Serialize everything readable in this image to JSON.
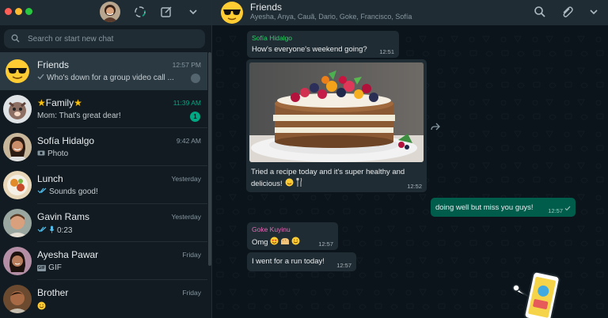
{
  "sidebar": {
    "search_placeholder": "Search or start new chat",
    "chats": [
      {
        "name": "Friends",
        "preview": "Who's down for a group video call ...",
        "time": "12:57 PM"
      },
      {
        "name": "Family",
        "preview": "Mom: That's great dear!",
        "time": "11:39 AM",
        "unread": "1"
      },
      {
        "name": "Sofía Hidalgo",
        "preview": "Photo",
        "time": "9:42 AM"
      },
      {
        "name": "Lunch",
        "preview": "Sounds good!",
        "time": "Yesterday"
      },
      {
        "name": "Gavin Rams",
        "preview": "0:23",
        "time": "Yesterday"
      },
      {
        "name": "Ayesha Pawar",
        "preview": "GIF",
        "time": "Friday",
        "gif_label": "GIF"
      },
      {
        "name": "Brother",
        "preview": "",
        "time": "Friday"
      }
    ]
  },
  "chat": {
    "title": "Friends",
    "members": "Ayesha, Anya, Cauã, Dario, Goke, Francisco, Sofía",
    "messages": [
      {
        "sender": "Sofía Hidalgo",
        "sender_color": "#25d366",
        "text": "How's everyone's weekend going?",
        "time": "12:51"
      },
      {
        "caption_line1": "Tried a recipe today and it's super healthy and",
        "caption_line2": "delicious!",
        "time": "12:52"
      },
      {
        "text": "doing well but miss you guys!",
        "time": "12:57"
      },
      {
        "sender": "Goke Kuyinu",
        "sender_color": "#e26ab6",
        "text": "Omg",
        "time": "12:57"
      },
      {
        "text": "I went for a run today!",
        "time": "12:57"
      }
    ]
  },
  "colors": {
    "accent": "#00a884",
    "sidebar_bg": "#111b21",
    "header_bg": "#202c33",
    "incoming_bubble": "#202c33",
    "outgoing_bubble": "#005c4b"
  }
}
